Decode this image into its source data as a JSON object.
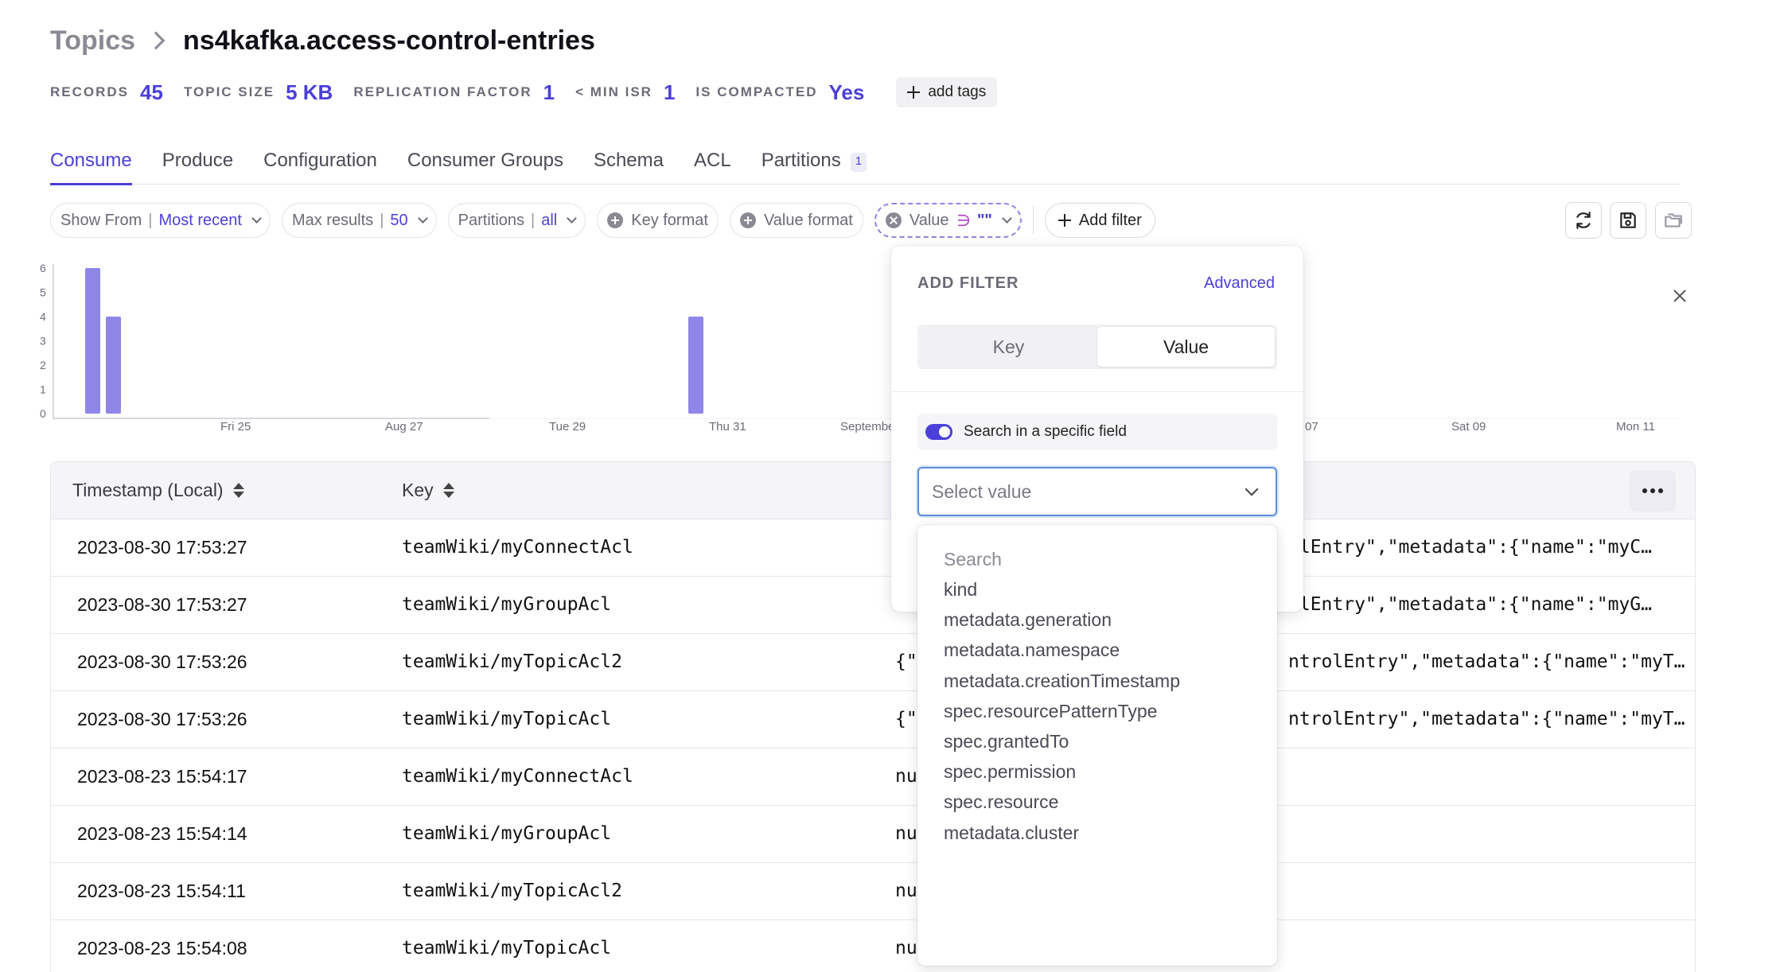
{
  "breadcrumb": {
    "parent": "Topics",
    "current": "ns4kafka.access-control-entries"
  },
  "stats": [
    {
      "label": "RECORDS",
      "value": "45"
    },
    {
      "label": "TOPIC SIZE",
      "value": "5 KB"
    },
    {
      "label": "REPLICATION FACTOR",
      "value": "1"
    },
    {
      "label": "< MIN ISR",
      "value": "1"
    },
    {
      "label": "IS COMPACTED",
      "value": "Yes"
    }
  ],
  "add_tags_label": "add tags",
  "tabs": [
    {
      "label": "Consume",
      "active": true
    },
    {
      "label": "Produce"
    },
    {
      "label": "Configuration"
    },
    {
      "label": "Consumer Groups"
    },
    {
      "label": "Schema"
    },
    {
      "label": "ACL"
    },
    {
      "label": "Partitions",
      "badge": "1"
    }
  ],
  "filters": {
    "show_from": {
      "label": "Show From",
      "value": "Most recent"
    },
    "max_results": {
      "label": "Max results",
      "value": "50"
    },
    "partitions": {
      "label": "Partitions",
      "value": "all"
    },
    "key_format": "Key format",
    "value_format": "Value format",
    "value_filter": {
      "label": "Value",
      "operator": "∋",
      "query": "\"\""
    },
    "add_filter": "Add filter"
  },
  "chart_data": {
    "type": "bar",
    "y_ticks": [
      "6",
      "5",
      "4",
      "3",
      "2",
      "1",
      "0"
    ],
    "ylim": [
      0,
      6
    ],
    "x_ticks": [
      "Fri 25",
      "Aug 27",
      "Tue 29",
      "Thu 31",
      "September",
      "07",
      "Sat 09",
      "Mon 11"
    ],
    "bars": [
      {
        "label": "Aug 23",
        "value": 6
      },
      {
        "label": "Aug 23",
        "value": 4
      },
      {
        "label": "Aug 30",
        "value": 4
      }
    ],
    "color": "#8f86e8"
  },
  "table": {
    "columns": [
      "Timestamp (Local)",
      "Key"
    ],
    "rows": [
      {
        "timestamp": "2023-08-30 17:53:27",
        "key": "teamWiki/myConnectAcl",
        "value_left": "",
        "value_right": "olEntry\",\"metadata\":{\"name\":\"myC…"
      },
      {
        "timestamp": "2023-08-30 17:53:27",
        "key": "teamWiki/myGroupAcl",
        "value_left": "",
        "value_right": "olEntry\",\"metadata\":{\"name\":\"myG…"
      },
      {
        "timestamp": "2023-08-30 17:53:26",
        "key": "teamWiki/myTopicAcl2",
        "value_left": "{\"",
        "value_right": "ntrolEntry\",\"metadata\":{\"name\":\"myT…"
      },
      {
        "timestamp": "2023-08-30 17:53:26",
        "key": "teamWiki/myTopicAcl",
        "value_left": "{\"",
        "value_right": "ntrolEntry\",\"metadata\":{\"name\":\"myT…"
      },
      {
        "timestamp": "2023-08-23 15:54:17",
        "key": "teamWiki/myConnectAcl",
        "value_left": "nu",
        "value_right": ""
      },
      {
        "timestamp": "2023-08-23 15:54:14",
        "key": "teamWiki/myGroupAcl",
        "value_left": "nu",
        "value_right": ""
      },
      {
        "timestamp": "2023-08-23 15:54:11",
        "key": "teamWiki/myTopicAcl2",
        "value_left": "nu",
        "value_right": ""
      },
      {
        "timestamp": "2023-08-23 15:54:08",
        "key": "teamWiki/myTopicAcl",
        "value_left": "nu",
        "value_right": ""
      }
    ]
  },
  "add_filter_popover": {
    "title": "ADD FILTER",
    "advanced": "Advanced",
    "segments": [
      {
        "label": "Key"
      },
      {
        "label": "Value",
        "active": true
      }
    ],
    "toggle_label": "Search in a specific field",
    "toggle_on": true,
    "select_placeholder": "Select value",
    "search_placeholder": "Search",
    "options": [
      "kind",
      "metadata.generation",
      "metadata.namespace",
      "metadata.creationTimestamp",
      "spec.resourcePatternType",
      "spec.grantedTo",
      "spec.permission",
      "spec.resource",
      "metadata.cluster"
    ]
  },
  "colors": {
    "accent": "#4b3fd9",
    "bar": "#8f86e8",
    "focus": "#5b8fd9"
  }
}
